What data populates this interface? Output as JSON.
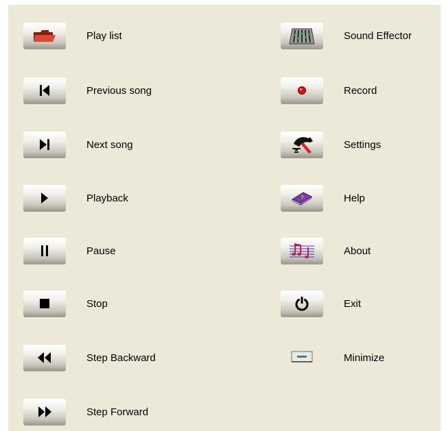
{
  "left_items": [
    {
      "label": "Play list",
      "icon": "folder-icon"
    },
    {
      "label": "Previous song",
      "icon": "previous-icon"
    },
    {
      "label": "Next song",
      "icon": "next-icon"
    },
    {
      "label": "Playback",
      "icon": "play-icon"
    },
    {
      "label": "Pause",
      "icon": "pause-icon"
    },
    {
      "label": "Stop",
      "icon": "stop-icon"
    },
    {
      "label": "Step Backward",
      "icon": "rewind-icon"
    },
    {
      "label": "Step Forward",
      "icon": "fast-forward-icon"
    }
  ],
  "right_items": [
    {
      "label": "Sound Effector",
      "icon": "equalizer-icon"
    },
    {
      "label": "Record",
      "icon": "record-icon"
    },
    {
      "label": "Settings",
      "icon": "hammer-icon"
    },
    {
      "label": "Help",
      "icon": "help-book-icon"
    },
    {
      "label": "About",
      "icon": "music-notes-icon"
    },
    {
      "label": "Exit",
      "icon": "power-icon"
    },
    {
      "label": "Minimize",
      "icon": "minimize-icon"
    }
  ],
  "colors": {
    "panel_background": "#ece9d8",
    "folder": "#c0392b",
    "record": "#cc1a1a",
    "help_book": "#7a3aa8",
    "music_notes": "#5b2bb5"
  }
}
